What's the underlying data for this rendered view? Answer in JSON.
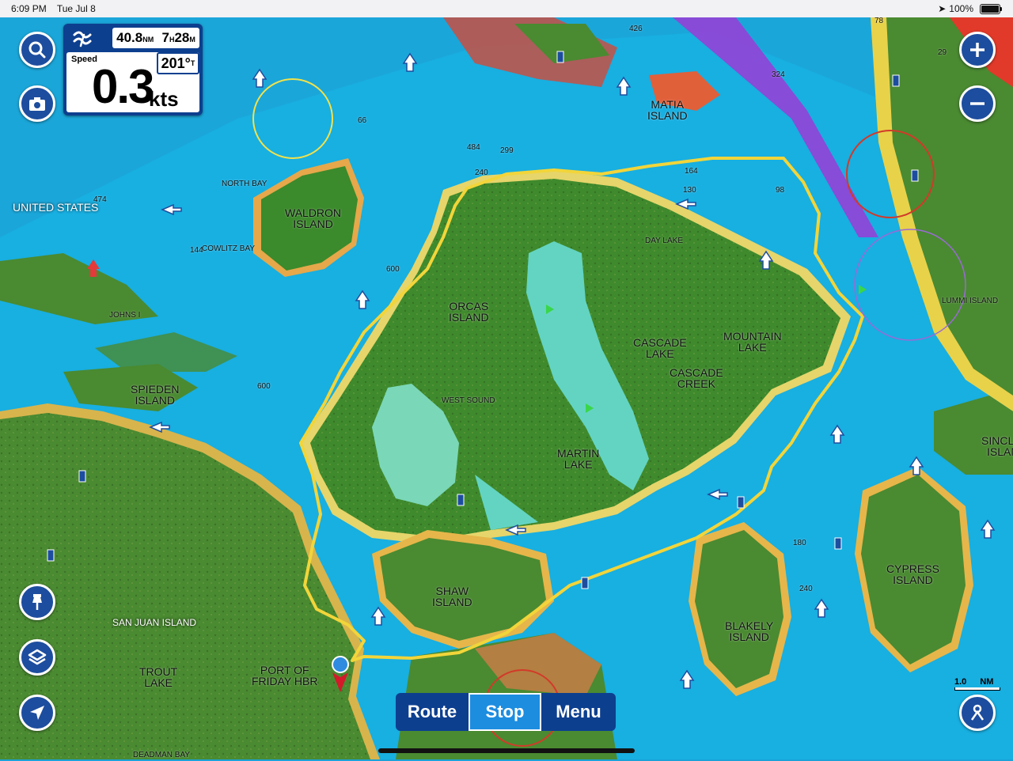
{
  "status": {
    "time": "6:09 PM",
    "date": "Tue Jul 8",
    "battery": "100%"
  },
  "nav_panel": {
    "distance_value": "40.8",
    "distance_unit": "NM",
    "time_value": "7",
    "time_unit_h": "H",
    "time_minutes": "28",
    "time_unit_m": "M",
    "speed_label": "Speed",
    "speed_value": "0.3",
    "speed_unit": "kts",
    "heading_value": "201°",
    "heading_unit": "T"
  },
  "bottom_bar": {
    "route": "Route",
    "stop": "Stop",
    "menu": "Menu"
  },
  "scale": {
    "value": "1.0",
    "unit": "NM"
  },
  "icons": [
    "search-icon",
    "camera-icon",
    "zoom-in-icon",
    "zoom-out-icon",
    "pin-icon",
    "layers-icon",
    "locate-icon",
    "profile-icon"
  ],
  "labels": {
    "united_states": "UNITED STATES",
    "north_bay": "NORTH BAY",
    "waldron_island": "WALDRON\nISLAND",
    "cowlitz_bay": "COWLITZ BAY",
    "johns": "JOHNS I",
    "speiden": "SPIEDEN\nISLAND",
    "orcas_island": "ORCAS\nISLAND",
    "west_sound": "WEST SOUND",
    "day_lake": "DAY LAKE",
    "cascade_lake": "CASCADE\nLAKE",
    "mountain_lake": "MOUNTAIN\nLAKE",
    "cascade_creek": "CASCADE\nCREEK",
    "martin_lake": "MARTIN\nLAKE",
    "matia_island": "MATIA\nISLAND",
    "lummi_island": "LUMMI ISLAND",
    "sinclair_island": "SINCLAIR\nISLAND",
    "cypress_island": "CYPRESS\nISLAND",
    "blakely_island": "BLAKELY\nISLAND",
    "shaw_island": "SHAW\nISLAND",
    "san_juan_island": "SAN JUAN ISLAND",
    "port_friday": "PORT OF\nFRIDAY HBR",
    "trout_lake": "TROUT\nLAKE",
    "deadman_bay": "DEADMAN BAY"
  },
  "depths": [
    "426",
    "324",
    "78",
    "29",
    "66",
    "484",
    "299",
    "240",
    "164",
    "130",
    "98",
    "474",
    "144",
    "600",
    "600",
    "180",
    "240"
  ]
}
